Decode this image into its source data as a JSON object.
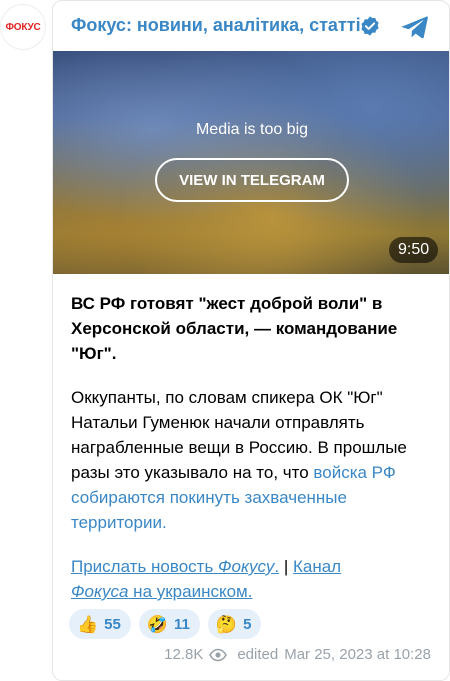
{
  "avatar": {
    "label": "ФОКУС"
  },
  "channel": {
    "name": "Фокус: новини, аналітика, статті"
  },
  "media": {
    "message": "Media is too big",
    "button_label": "VIEW IN TELEGRAM",
    "duration": "9:50"
  },
  "post": {
    "title": "ВС РФ готовят \"жест доброй воли\" в Херсонской области, — командование \"Юг\".",
    "body_plain": "Оккупанты, по словам спикера ОК \"Юг\" Натальи Гуменюк начали отправлять награбленные вещи в Россию. В прошлые разы это указывало на то, что ",
    "body_link": "войска РФ собираются покинуть захваченные территории."
  },
  "links": {
    "send_news_prefix": "Прислать новость ",
    "send_news_em": "Фокусу",
    "send_news_suffix": ".",
    "separator": " | ",
    "channel_prefix": "Канал",
    "channel_em": "Фокуса",
    "channel_suffix": " на украинском."
  },
  "reactions": [
    {
      "emoji": "👍",
      "count": "55"
    },
    {
      "emoji": "🤣",
      "count": "11"
    },
    {
      "emoji": "🤔",
      "count": "5"
    }
  ],
  "footer": {
    "views": "12.8K",
    "edited_label": "edited",
    "timestamp": "Mar 25, 2023 at 10:28"
  },
  "colors": {
    "accent": "#3a87c6",
    "brand_red": "#e02222",
    "reaction_bg": "#e5f0fa",
    "meta_gray": "#9aa2a9"
  },
  "icons": [
    "verified-icon",
    "telegram-icon",
    "eye-icon"
  ]
}
